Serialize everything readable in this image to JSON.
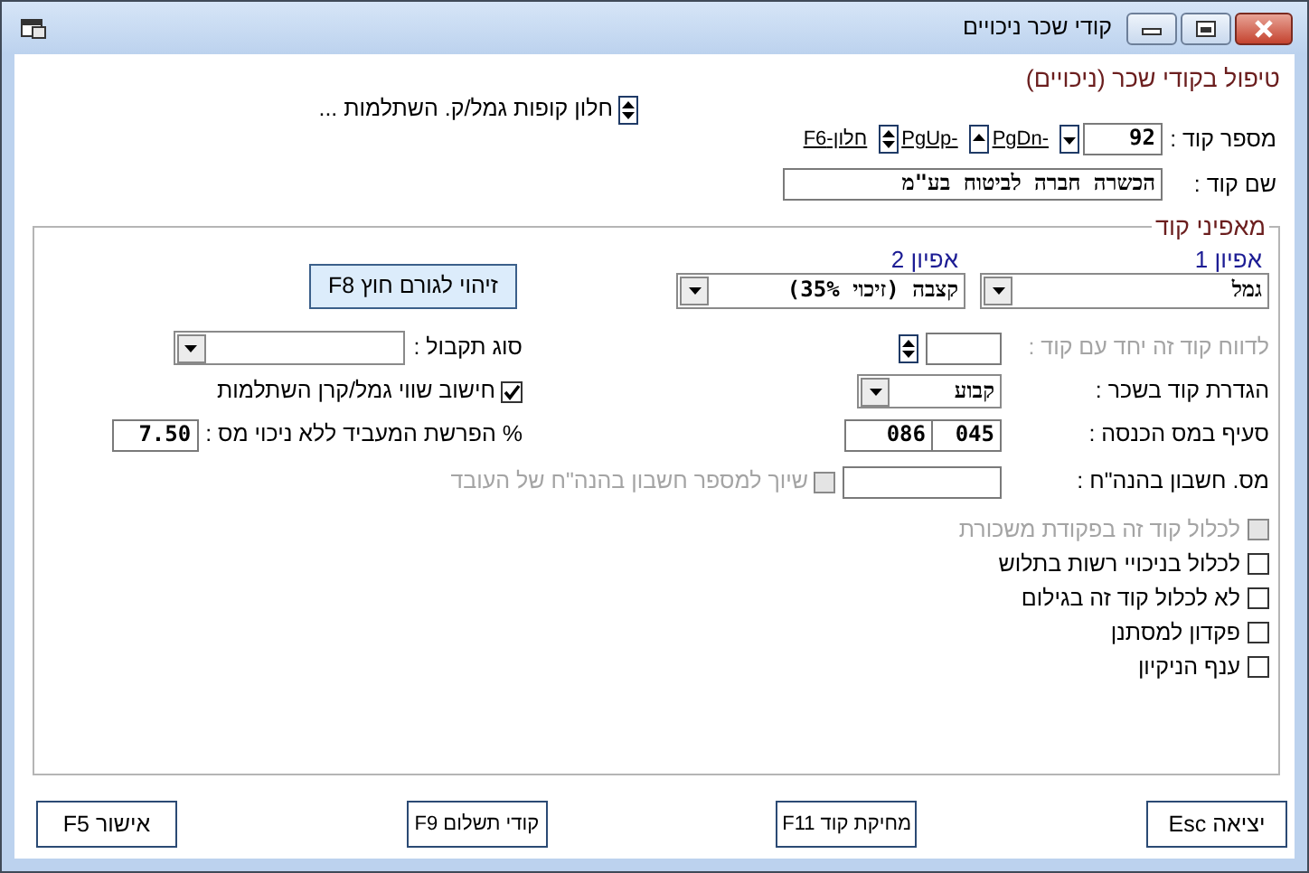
{
  "window": {
    "title": "קודי שכר ניכויים"
  },
  "heading": "טיפול בקודי שכר (ניכויים)",
  "funds_link": "חלון קופות גמל/ק. השתלמות ...",
  "code_number": {
    "label": "מספר קוד :",
    "value": "92"
  },
  "nav_links": [
    {
      "kind": "down",
      "label": "PgDn-"
    },
    {
      "kind": "up",
      "label": "PgUp-"
    },
    {
      "kind": "updown",
      "label": "חלון-F6"
    }
  ],
  "code_name": {
    "label": "שם קוד :",
    "value": "הכשרה חברה לביטוח בע\"מ"
  },
  "group": {
    "title": "מאפיני קוד",
    "characteristics": [
      {
        "label": "אפיון 1",
        "value": "גמל"
      },
      {
        "label": "אפיון 2",
        "value": "קצבה (זיכוי 35%)"
      }
    ],
    "external_button": "זיהוי לגורם חוץ F8",
    "report_with": {
      "label": "לדווח קוד זה יחד עם קוד :",
      "disabled": true
    },
    "salary_definition": {
      "label": "הגדרת קוד בשכר :",
      "value": "קבוע"
    },
    "tax_section": {
      "label": "סעיף במס הכנסה :",
      "values": [
        "045",
        "086"
      ]
    },
    "account_number": {
      "label": "מס. חשבון בהנה\"ח :"
    },
    "assign_account": {
      "label": "שיוך למספר חשבון בהנה\"ח של העובד",
      "checked": false,
      "disabled": true
    },
    "receipt_type": {
      "label": "סוג תקבול :"
    },
    "calc_fund": {
      "label": "חישוב שווי גמל/קרן השתלמות",
      "checked": true
    },
    "employer_pct": {
      "label": "% הפרשת המעביד ללא ניכוי מס :",
      "value": "7.50"
    },
    "options": [
      {
        "label": "לכלול קוד זה בפקודת משכורת",
        "checked": false,
        "disabled": true
      },
      {
        "label": "לכלול בניכויי רשות בתלוש",
        "checked": false,
        "disabled": false
      },
      {
        "label": "לא לכלול קוד זה בגילום",
        "checked": false,
        "disabled": false
      },
      {
        "label": "פקדון למסתנן",
        "checked": false,
        "disabled": false
      },
      {
        "label": "ענף הניקיון",
        "checked": false,
        "disabled": false
      }
    ]
  },
  "buttons": [
    {
      "label": "יציאה Esc"
    },
    {
      "label": "מחיקת קוד F11"
    },
    {
      "label": "קודי תשלום F9"
    },
    {
      "label": "אישור F5"
    }
  ]
}
